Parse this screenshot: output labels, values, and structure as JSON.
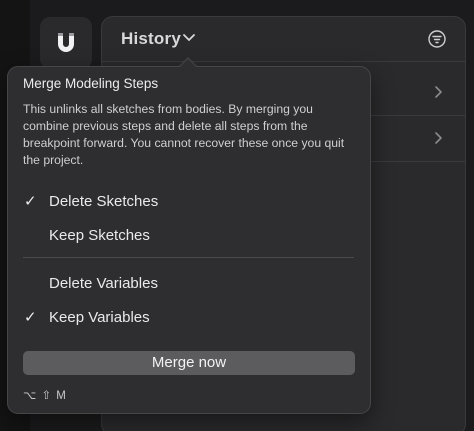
{
  "panel": {
    "title": "History"
  },
  "popover": {
    "title": "Merge Modeling Steps",
    "description": "This unlinks all sketches from bodies. By merging you combine previous steps and delete all steps from the breakpoint forward. You cannot recover these once you quit the project.",
    "options": [
      {
        "label": "Delete Sketches",
        "checked": true,
        "check_glyph": "✓"
      },
      {
        "label": "Keep Sketches",
        "checked": false,
        "check_glyph": ""
      },
      {
        "label": "Delete Variables",
        "checked": false,
        "check_glyph": ""
      },
      {
        "label": "Keep Variables",
        "checked": true,
        "check_glyph": "✓"
      }
    ],
    "merge_label": "Merge now",
    "shortcut": "⌥ ⇧ M"
  },
  "icons": {
    "tool": "magnet-icon",
    "filter": "filter-icon",
    "title_chevron": "chevron-down-icon",
    "row_chevron": "chevron-right-icon"
  }
}
